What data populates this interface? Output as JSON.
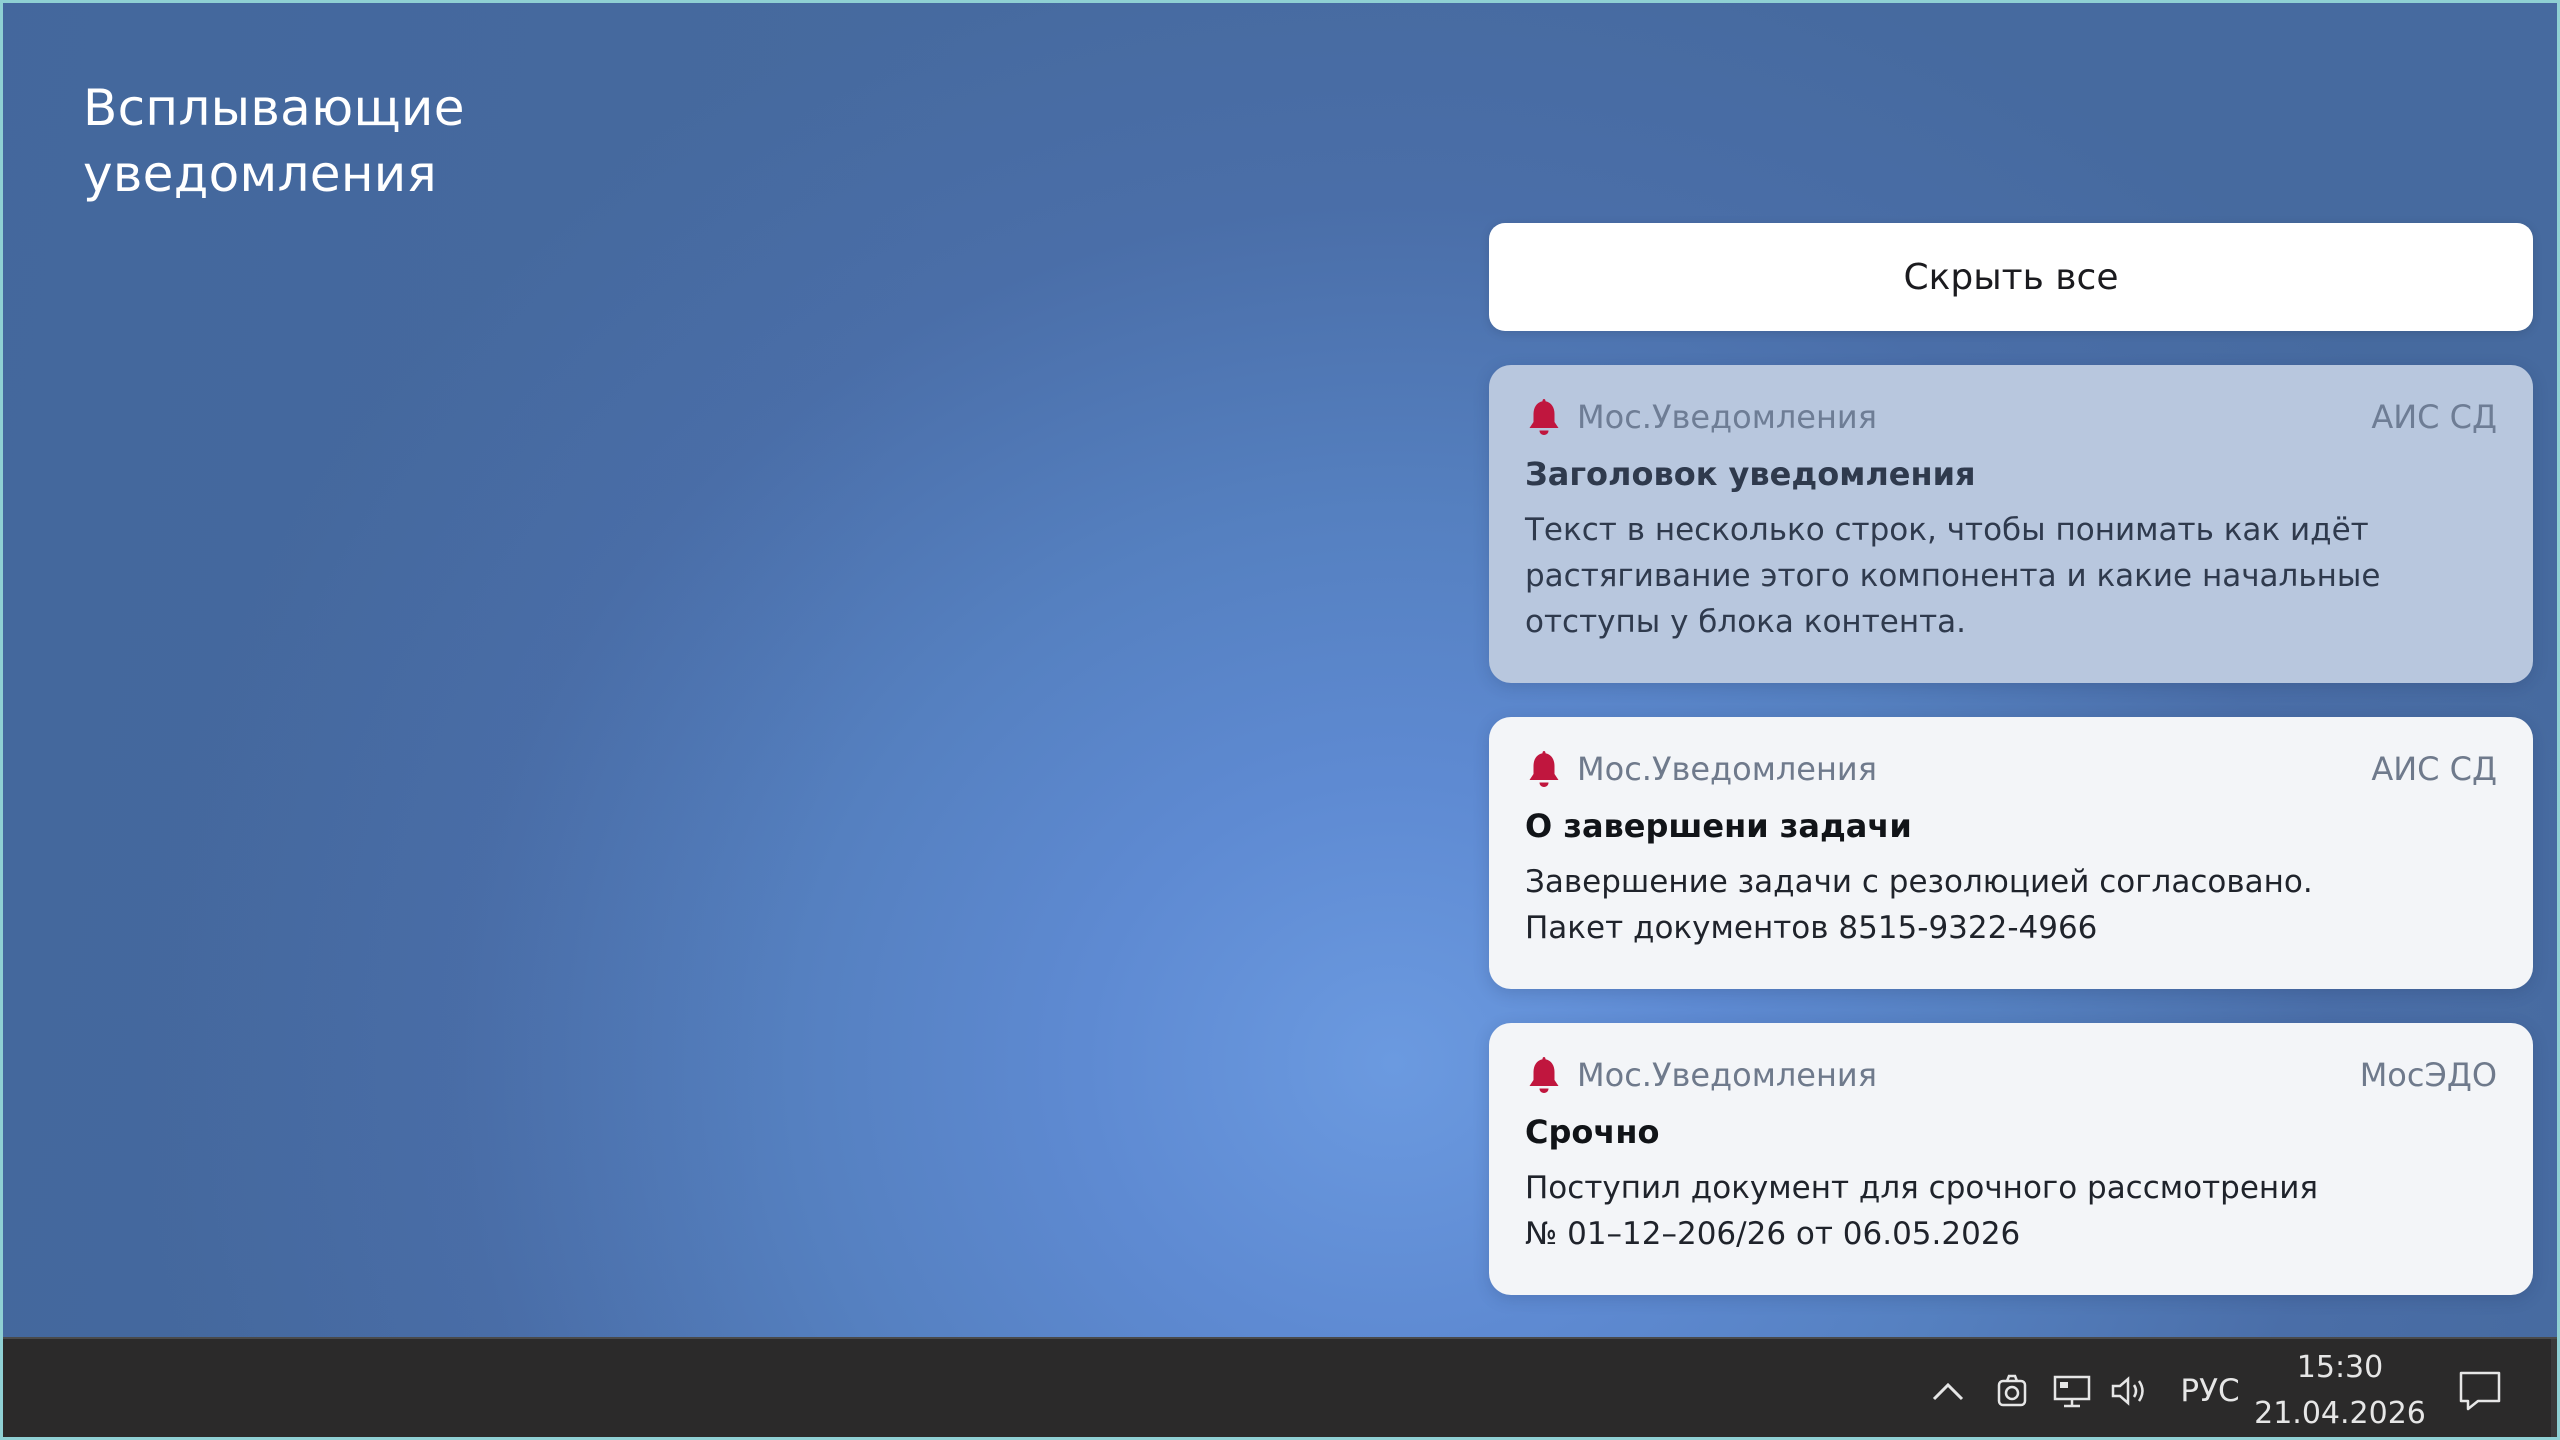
{
  "page_title": "Всплывающие уведомления",
  "hide_all_label": "Скрыть все",
  "notifications": [
    {
      "app": "Мос.Уведомления",
      "source": "АИС СД",
      "title": "Заголовок уведомления",
      "text": "Текст в несколько строк, чтобы понимать как идёт растягивание этого компонента и какие начальные отступы у блока контента.",
      "state": "faded"
    },
    {
      "app": "Мос.Уведомления",
      "source": "АИС СД",
      "title": "О завершени задачи",
      "text_lines": [
        "Завершение задачи с резолюцией согласовано.",
        "Пакет документов 8515-9322-4966"
      ]
    },
    {
      "app": "Мос.Уведомления",
      "source": "МосЭДО",
      "title": "Срочно",
      "text_lines": [
        "Поступил документ для срочного рассмотрения",
        "№ 01–12–206/26 от 06.05.2026"
      ]
    }
  ],
  "taskbar": {
    "icons": [
      "chevron-up-icon",
      "camera-icon",
      "network-icon",
      "volume-icon",
      "chat-icon"
    ],
    "language": "РУС",
    "time": "15:30",
    "date": "21.04.2026"
  },
  "colors": {
    "bell": "#c0163e",
    "taskbar": "#2b2a2a",
    "card": "#f3f5f8",
    "card_faded": "#b8c7de"
  }
}
